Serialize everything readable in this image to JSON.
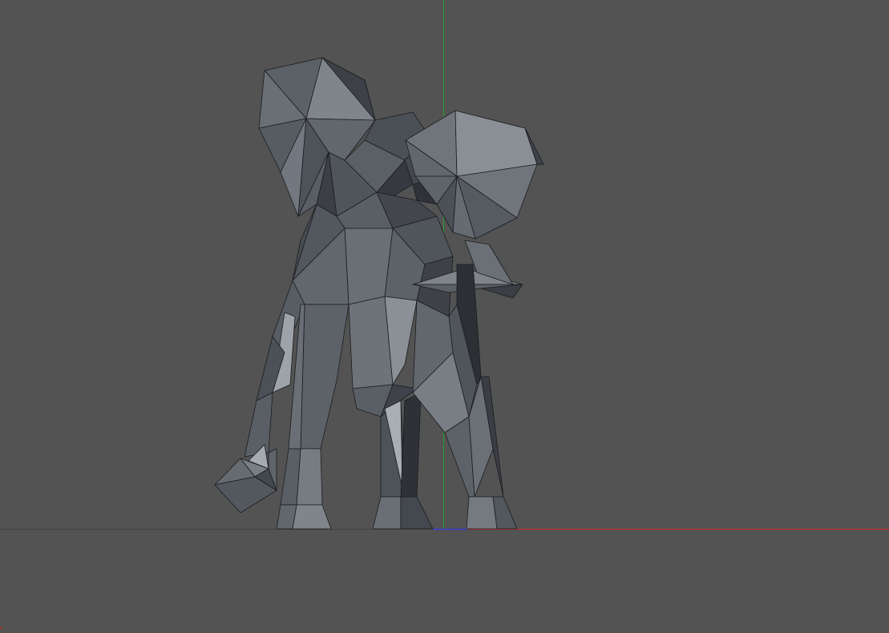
{
  "viewport": {
    "background_color": "#535353",
    "view_label": ""
  },
  "axes": {
    "x_axis_color": "#cc2a2a",
    "y_axis_color": "#2aa02a",
    "z_axis_color": "#3a3ad0",
    "ground_line_color": "#444444"
  },
  "model": {
    "name": "",
    "style": "low-poly flat shaded",
    "base_color": "#5d6268",
    "wireframe_color": "#1a1c1f"
  }
}
